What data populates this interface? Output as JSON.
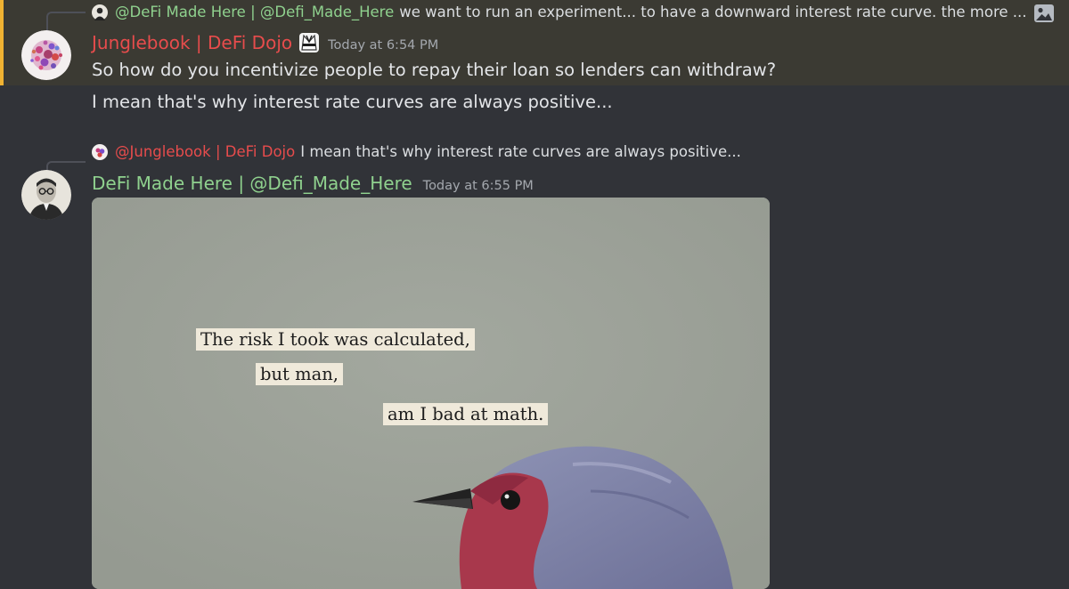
{
  "messages": [
    {
      "reply": {
        "mention": "@DeFi Made Here | @Defi_Made_Here",
        "text": "we want to run an experiment... to have a downward interest rate curve. the more ..."
      },
      "author": "Junglebook | DeFi Dojo",
      "timestamp": "Today at 6:54 PM",
      "lines": [
        "So how do you incentivize people to repay their loan so lenders can withdraw?",
        "I mean that's why interest rate curves are always positive..."
      ],
      "author_color": "#e74c4c",
      "highlighted": true
    },
    {
      "reply": {
        "mention": "@Junglebook | DeFi Dojo",
        "text": "I mean that's why interest rate curves are always positive..."
      },
      "author": "DeFi Made Here | @Defi_Made_Here",
      "timestamp": "Today at 6:55 PM",
      "author_color": "#8fd18e",
      "attachment": {
        "caption_lines": [
          "The risk I took was calculated,",
          "but man,",
          "am I bad at math."
        ]
      }
    }
  ],
  "icons": {
    "reply_image": "image-icon",
    "role_badge": "dojo-gi-icon"
  },
  "colors": {
    "background": "#313338",
    "highlight_bg": "#3b3a33",
    "highlight_accent": "#f0b232"
  }
}
